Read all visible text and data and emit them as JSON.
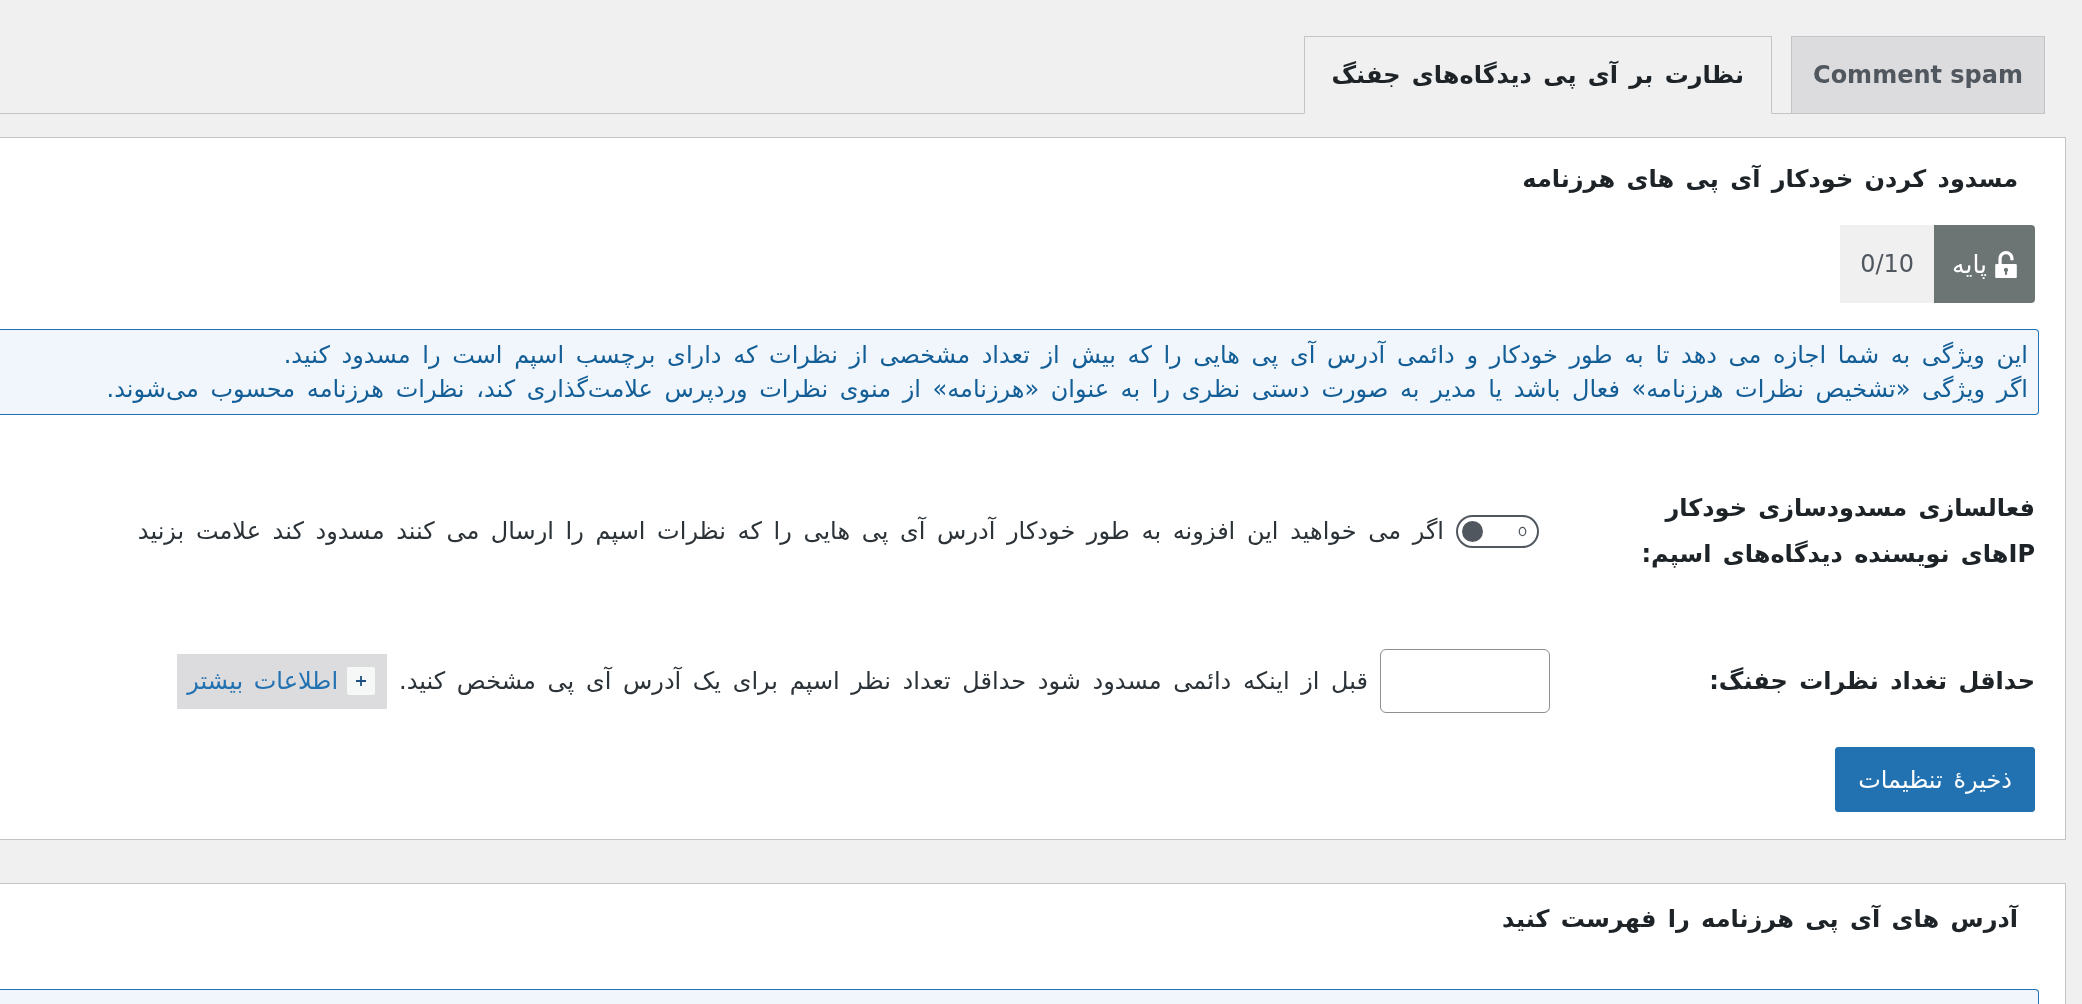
{
  "tabs": [
    {
      "label": "Comment spam",
      "selected": false
    },
    {
      "label": "نظارت بر آی پی دیدگاه‌های جفنگ",
      "selected": true
    }
  ],
  "panels": [
    {
      "title": "مسدود کردن خودکار آی پی های هرزنامه",
      "badge": {
        "tier": "پایه",
        "score": "0/10"
      },
      "notice": [
        "این ویژگی به شما اجازه می دهد تا به طور خودکار و دائمی آدرس آی پی هایی را که بیش از تعداد مشخصی از نظرات که دارای برچسب اسپم است را مسدود کنید.",
        "اگر ویژگی «تشخیص نظرات هرزنامه» فعال باشد یا مدیر به صورت دستی نظری را به عنوان «هرزنامه» از منوی نظرات وردپرس علامت‌گذاری کند، نظرات هرزنامه محسوب می‌شوند."
      ],
      "settings": [
        {
          "kind": "toggle",
          "label": "فعالسازی مسدودسازی خودکار IPهای نویسنده دیدگاه‌های اسپم:",
          "checked": false,
          "description": "اگر می خواهید این افزونه به طور خودکار آدرس آی پی هایی را که نظرات اسپم را ارسال می کنند مسدود کند علامت بزنید"
        },
        {
          "kind": "number",
          "label": "حداقل تغداد نظرات جفنگ:",
          "description": "قبل از اینکه دائمی مسدود شود حداقل تعداد نظر اسپم برای یک آدرس آی پی مشخص کنید.",
          "more_info": "اطلاعات بیشتر"
        }
      ],
      "save_button": "ذخیرهٔ تنظیمات"
    },
    {
      "title": "آدرس های آی پی هرزنامه را فهرست کنید"
    }
  ]
}
